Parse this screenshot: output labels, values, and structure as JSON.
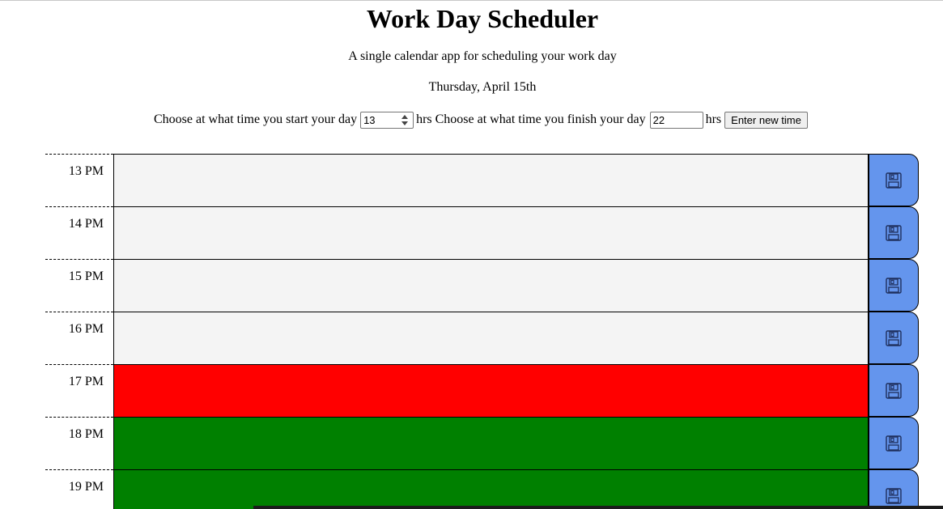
{
  "header": {
    "title": "Work Day Scheduler",
    "subtitle": "A single calendar app for scheduling your work day",
    "date": "Thursday, April 15th"
  },
  "time_form": {
    "start_label": "Choose at what time you start your day",
    "start_value": "13",
    "hrs_label_1": "hrs",
    "finish_label": "Choose at what time you finish your day",
    "finish_value": "22",
    "hrs_label_2": "hrs",
    "button_label": "Enter new time"
  },
  "schedule": {
    "rows": [
      {
        "hour": "13 PM",
        "status": "past"
      },
      {
        "hour": "14 PM",
        "status": "past"
      },
      {
        "hour": "15 PM",
        "status": "past"
      },
      {
        "hour": "16 PM",
        "status": "past"
      },
      {
        "hour": "17 PM",
        "status": "present"
      },
      {
        "hour": "18 PM",
        "status": "future"
      },
      {
        "hour": "19 PM",
        "status": "future"
      }
    ]
  },
  "colors": {
    "past": "#f4f4f4",
    "present": "#ff0000",
    "future": "#008000",
    "save_button": "#6495ed"
  },
  "icons": {
    "save": "floppy-disk-icon"
  }
}
